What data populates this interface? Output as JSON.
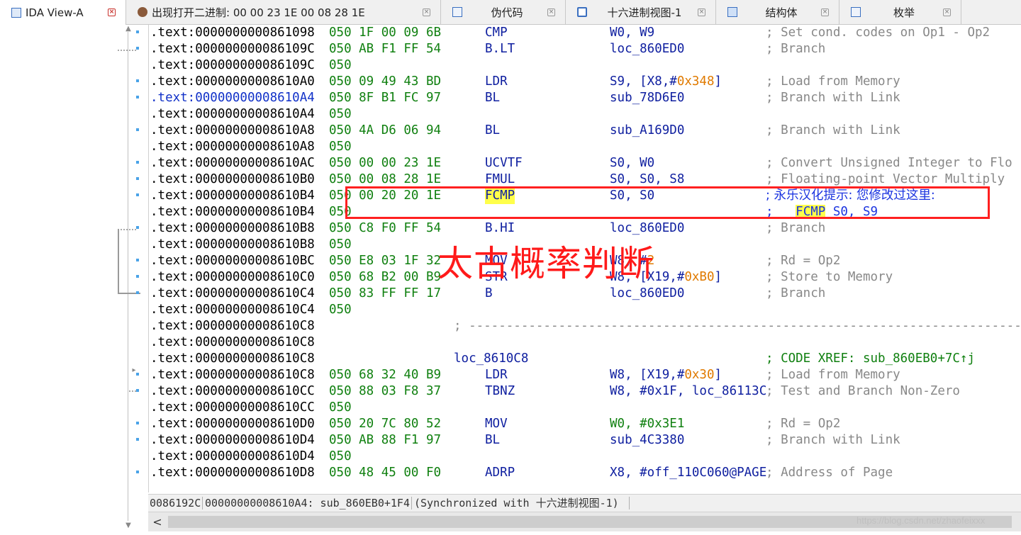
{
  "tabs": [
    {
      "label": "IDA View-A",
      "icon": "ida-view-icon",
      "active": true
    },
    {
      "label": "出现打开二进制: 00 00 23 1E 00 08 28 1E",
      "icon": "person-icon",
      "active": false
    },
    {
      "label": "伪代码",
      "icon": "pseudocode-icon",
      "active": false
    },
    {
      "label": "十六进制视图-1",
      "icon": "hex-view-icon",
      "active": false
    },
    {
      "label": "结构体",
      "icon": "struct-icon",
      "active": false
    },
    {
      "label": "枚举",
      "icon": "enum-icon",
      "active": false
    }
  ],
  "close_glyph": "×",
  "rows": [
    {
      "addr": ".text:0000000000861098",
      "bytes": "050 1F 00 09 6B",
      "mnem": "CMP",
      "ops": "W0, W9",
      "cmt": "; Set cond. codes on Op1 - Op2"
    },
    {
      "addr": ".text:000000000086109C",
      "bytes": "050 AB F1 FF 54",
      "mnem": "B.LT",
      "ops": "loc_860ED0",
      "cmt": "; Branch"
    },
    {
      "addr": ".text:000000000086109C",
      "bytes": "050"
    },
    {
      "addr": ".text:00000000008610A0",
      "bytes": "050 09 49 43 BD",
      "mnem": "LDR",
      "ops_pre": "S9, [X8,#",
      "ops_num": "0x348",
      "ops_post": "]",
      "cmt": "; Load from Memory"
    },
    {
      "addr": ".text:00000000008610A4",
      "bytes": "050 8F B1 FC 97",
      "mnem": "BL",
      "ops": "sub_78D6E0",
      "cmt": "; Branch with Link",
      "blue": true
    },
    {
      "addr": ".text:00000000008610A4",
      "bytes": "050"
    },
    {
      "addr": ".text:00000000008610A8",
      "bytes": "050 4A D6 06 94",
      "mnem": "BL",
      "ops": "sub_A169D0",
      "cmt": "; Branch with Link"
    },
    {
      "addr": ".text:00000000008610A8",
      "bytes": "050"
    },
    {
      "addr": ".text:00000000008610AC",
      "bytes": "050 00 00 23 1E",
      "mnem": "UCVTF",
      "ops": "S0, W0",
      "cmt": "; Convert Unsigned Integer to Flo"
    },
    {
      "addr": ".text:00000000008610B0",
      "bytes": "050 00 08 28 1E",
      "mnem": "FMUL",
      "ops": "S0, S0, S8",
      "cmt": "; Floating-point Vector Multiply"
    },
    {
      "addr": ".text:00000000008610B4",
      "bytes": "050 00 20 20 1E",
      "mnem": "FCMP",
      "hl": true,
      "ops": "S0, S0",
      "cmt": "; 永乐汉化提示: 您修改过这里:",
      "cmt_blue": true
    },
    {
      "addr": ".text:00000000008610B4",
      "bytes": "050",
      "cmt_pre": ";   ",
      "cmt_hl": "FCMP",
      "cmt_post": " S0, S9",
      "cmt_blue": true
    },
    {
      "addr": ".text:00000000008610B8",
      "bytes": "050 C8 F0 FF 54",
      "mnem": "B.HI",
      "ops": "loc_860ED0",
      "cmt": "; Branch"
    },
    {
      "addr": ".text:00000000008610B8",
      "bytes": "050"
    },
    {
      "addr": ".text:00000000008610BC",
      "bytes": "050 E8 03 1F 32",
      "mnem": "MOV",
      "ops_pre": "W8, #",
      "ops_num": "2",
      "ops_post": "",
      "cmt": "; Rd = Op2"
    },
    {
      "addr": ".text:00000000008610C0",
      "bytes": "050 68 B2 00 B9",
      "mnem": "STR",
      "ops_pre": "W8, [X19,#",
      "ops_num": "0xB0",
      "ops_post": "]",
      "cmt": "; Store to Memory"
    },
    {
      "addr": ".text:00000000008610C4",
      "bytes": "050 83 FF FF 17",
      "mnem": "B",
      "ops": "loc_860ED0",
      "cmt": "; Branch"
    },
    {
      "addr": ".text:00000000008610C4",
      "bytes": "050"
    },
    {
      "addr": ".text:00000000008610C8",
      "sep": "; ---------------------------------------------------------------------------"
    },
    {
      "addr": ".text:00000000008610C8"
    },
    {
      "addr": ".text:00000000008610C8",
      "label": "loc_8610C8",
      "xref": "; CODE XREF: sub_860EB0+7C↑j"
    },
    {
      "addr": ".text:00000000008610C8",
      "bytes": "050 68 32 40 B9",
      "mnem": "LDR",
      "ops_pre": "W8, [X19,#",
      "ops_num": "0x30",
      "ops_post": "]",
      "cmt": "; Load from Memory"
    },
    {
      "addr": ".text:00000000008610CC",
      "bytes": "050 88 03 F8 37",
      "mnem": "TBNZ",
      "ops": "W8, #0x1F, loc_86113C",
      "cmt": "; Test and Branch Non-Zero"
    },
    {
      "addr": ".text:00000000008610CC",
      "bytes": "050"
    },
    {
      "addr": ".text:00000000008610D0",
      "bytes": "050 20 7C 80 52",
      "mnem": "MOV",
      "ops": "W0, #0x3E1",
      "cmt": "; Rd = Op2",
      "ops_green": true
    },
    {
      "addr": ".text:00000000008610D4",
      "bytes": "050 AB 88 F1 97",
      "mnem": "BL",
      "ops": "sub_4C3380",
      "cmt": "; Branch with Link"
    },
    {
      "addr": ".text:00000000008610D4",
      "bytes": "050"
    },
    {
      "addr": ".text:00000000008610D8",
      "bytes": "050 48 45 00 F0",
      "mnem": "ADRP",
      "ops": "X8, #off_110C060@PAGE",
      "cmt": "; Address of Page"
    }
  ],
  "annotation": {
    "text": "太古概率判断",
    "color": "#ff1a1a"
  },
  "status": {
    "offset": "0086192C",
    "location": "00000000008610A4: sub_860EB0+1F4",
    "sync": "(Synchronized with 十六进制视图-1)"
  },
  "scroll": {
    "left_arrow": "<"
  },
  "watermark": "https://blog.csdn.net/zhaofeixxx",
  "colors": {
    "address": "#000000",
    "bytes": "#108010",
    "instruction": "#1020a0",
    "comment": "#888888",
    "highlight": "#ffff4a",
    "number": "#e07a00",
    "annotation_box": "#ff2020"
  }
}
